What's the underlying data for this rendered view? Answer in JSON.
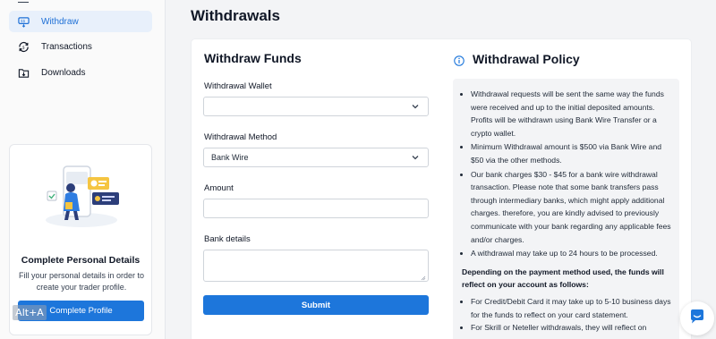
{
  "sidebar": {
    "items": [
      {
        "label": "Withdraw",
        "icon": "withdraw-icon",
        "active": true
      },
      {
        "label": "Transactions",
        "icon": "transactions-icon",
        "active": false
      },
      {
        "label": "Downloads",
        "icon": "downloads-icon",
        "active": false
      }
    ],
    "profile_card": {
      "title": "Complete Personal Details",
      "text": "Fill your personal details in order to create your trader profile.",
      "button_label": "Complete Profile"
    },
    "shortcut_badge": "Alt+A"
  },
  "page": {
    "title": "Withdrawals"
  },
  "form": {
    "title": "Withdraw Funds",
    "wallet_label": "Withdrawal Wallet",
    "wallet_value": "",
    "method_label": "Withdrawal Method",
    "method_value": "Bank Wire",
    "amount_label": "Amount",
    "amount_value": "",
    "bank_label": "Bank details",
    "bank_value": "",
    "submit_label": "Submit"
  },
  "policy": {
    "title": "Withdrawal Policy",
    "items": [
      "Withdrawal requests will be sent the same way the funds were received and up to the initial deposited amounts. Profits will be withdrawn using Bank Wire Transfer or a crypto wallet.",
      "Minimum Withdrawal amount is $500 via Bank Wire and $50 via the other methods.",
      "Our bank charges $30 - $45 for a bank wire withdrawal transaction. Please note that some bank transfers pass through intermediary banks, which might apply additional charges. therefore, you are kindly advised to previously communicate with your bank regarding any applicable fees and/or charges.",
      "A withdrawal may take up to 24 hours to be processed."
    ],
    "subheading": "Depending on the payment method used, the funds will reflect on your account as follows:",
    "items2": [
      "For Credit/Debit Card it may take up to 5-10 business days for the funds to reflect on your card statement.",
      "For Skrill or Neteller withdrawals, they will reflect on"
    ]
  },
  "colors": {
    "accent": "#1d76db",
    "active_nav_bg": "#e8f0fb",
    "page_bg": "#f3f4f6"
  }
}
